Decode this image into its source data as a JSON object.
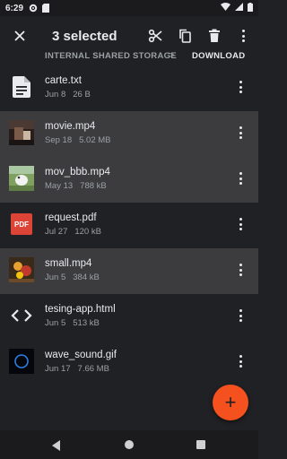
{
  "status_bar": {
    "time": "6:29"
  },
  "toolbar": {
    "title": "3 selected"
  },
  "breadcrumb": {
    "parent": "INTERNAL SHARED STORAGE",
    "separator": ">",
    "current": "DOWNLOAD"
  },
  "files": [
    {
      "name": "carte.txt",
      "date": "Jun 8",
      "size": "26 B",
      "selected": false,
      "thumb": "text-document-icon"
    },
    {
      "name": "movie.mp4",
      "date": "Sep 18",
      "size": "5.02 MB",
      "selected": true,
      "thumb": "video-thumbnail"
    },
    {
      "name": "mov_bbb.mp4",
      "date": "May 13",
      "size": "788 kB",
      "selected": true,
      "thumb": "video-thumbnail"
    },
    {
      "name": "request.pdf",
      "date": "Jul 27",
      "size": "120 kB",
      "selected": false,
      "thumb": "pdf-icon"
    },
    {
      "name": "small.mp4",
      "date": "Jun 5",
      "size": "384 kB",
      "selected": true,
      "thumb": "video-thumbnail"
    },
    {
      "name": "tesing-app.html",
      "date": "Jun 5",
      "size": "513 kB",
      "selected": false,
      "thumb": "code-icon"
    },
    {
      "name": "wave_sound.gif",
      "date": "Jun 17",
      "size": "7.66 MB",
      "selected": false,
      "thumb": "gif-thumbnail"
    }
  ],
  "pdf_badge": "PDF",
  "fab": {
    "icon": "plus-icon",
    "symbol": "+"
  },
  "colors": {
    "background": "#202124",
    "selected_row": "#3c3c3e",
    "fab": "#f4511e",
    "pdf_red": "#db4437"
  }
}
